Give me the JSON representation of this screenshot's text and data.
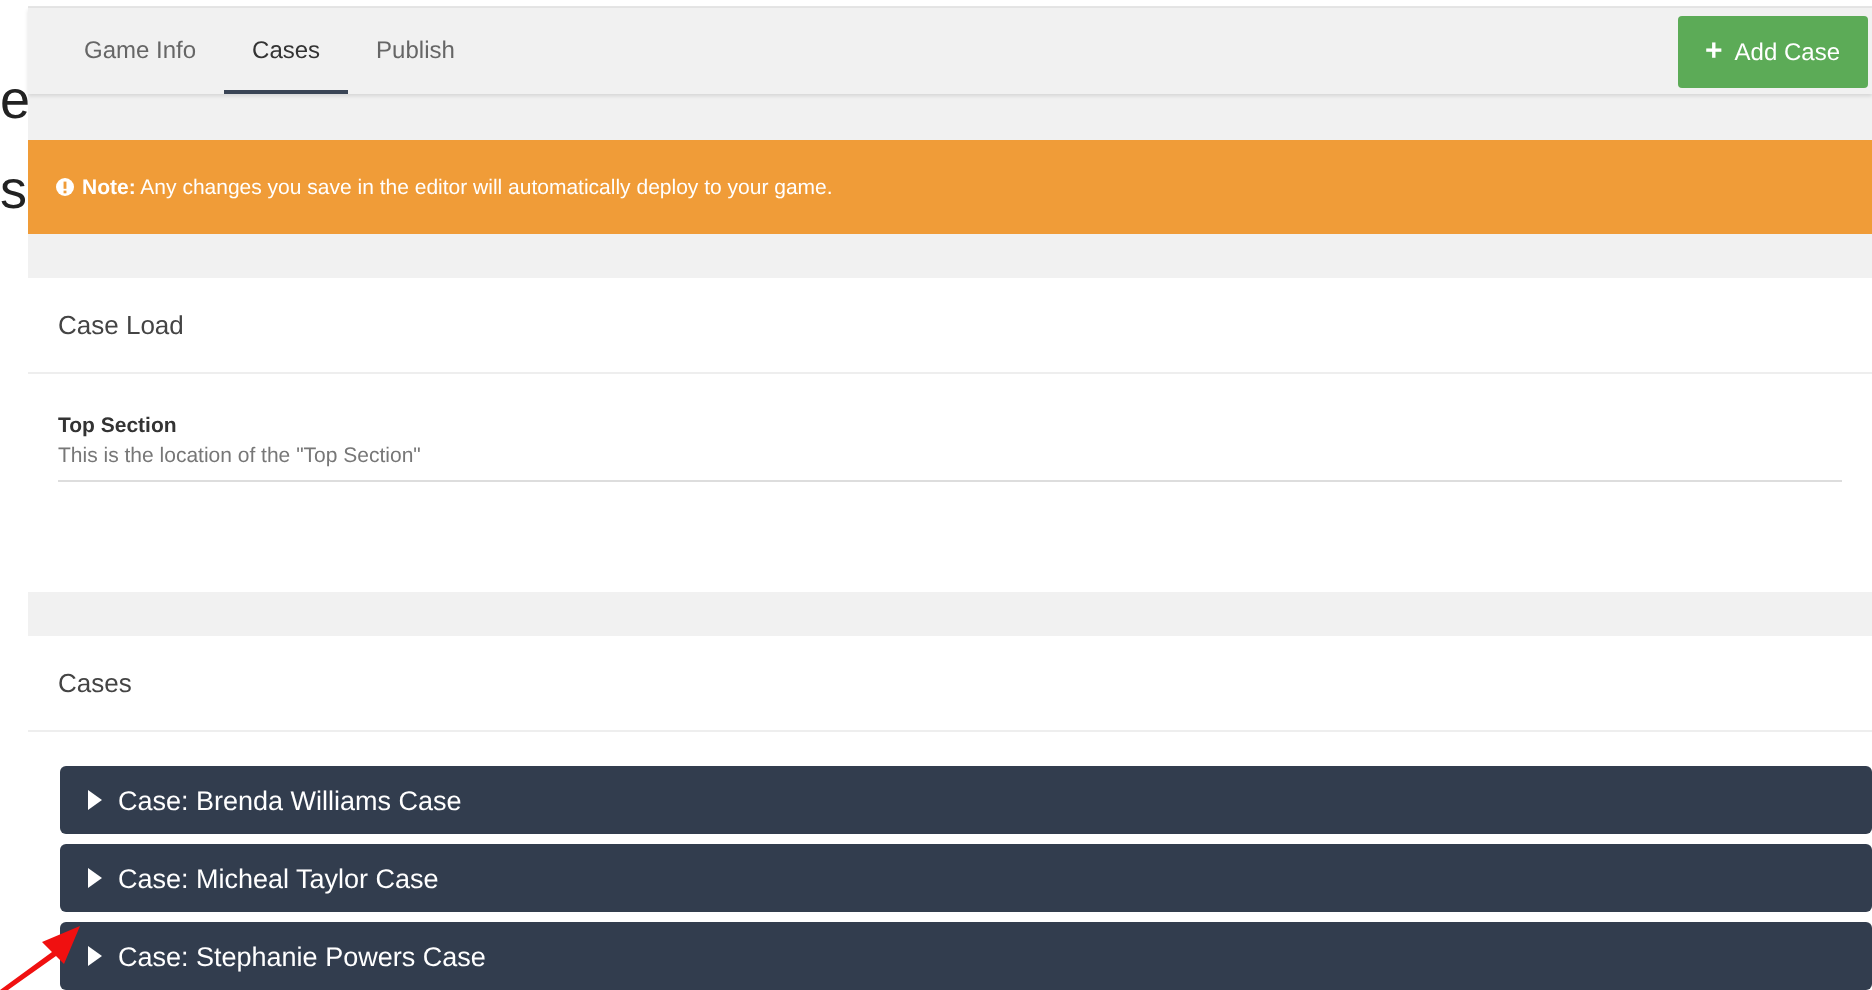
{
  "background_text": [
    "e",
    "s"
  ],
  "tabs": [
    {
      "label": "Game Info",
      "selected": false
    },
    {
      "label": "Cases",
      "selected": true
    },
    {
      "label": "Publish",
      "selected": false
    }
  ],
  "add_button": {
    "icon": "+",
    "label": "Add Case"
  },
  "note": {
    "text": "**Note:** Any changes you save in the editor will automatically deploy to your game."
  },
  "case_load": {
    "title": "Case Load",
    "field_label": "Top Section",
    "field_value": "This is the location of the \"Top Section\""
  },
  "cases": {
    "title": "Cases",
    "items": [
      {
        "label": "Case: Brenda Williams Case",
        "expanded": false
      },
      {
        "label": "Case: Micheal Taylor Case",
        "expanded": false
      },
      {
        "label": "Case: Stephanie Powers Case",
        "expanded": false
      }
    ]
  }
}
